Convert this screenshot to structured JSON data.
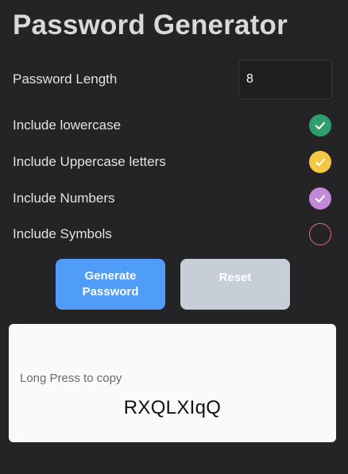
{
  "app": {
    "title": "Password Generator"
  },
  "length": {
    "label": "Password Length",
    "value": "8"
  },
  "options": [
    {
      "label": "Include lowercase",
      "checked": true,
      "color": "#2e9e6e"
    },
    {
      "label": "Include Uppercase letters",
      "checked": true,
      "color": "#f5c842"
    },
    {
      "label": "Include Numbers",
      "checked": true,
      "color": "#c08ad8"
    },
    {
      "label": "Include Symbols",
      "checked": false,
      "color": "#e0707e"
    }
  ],
  "buttons": {
    "generate_label": "Generate\nPassword",
    "generate_color": "#4f9df7",
    "reset_label": "Reset",
    "reset_color": "#c8ced8"
  },
  "result": {
    "hint": "Long Press to copy",
    "password": "RXQLXIqQ"
  }
}
